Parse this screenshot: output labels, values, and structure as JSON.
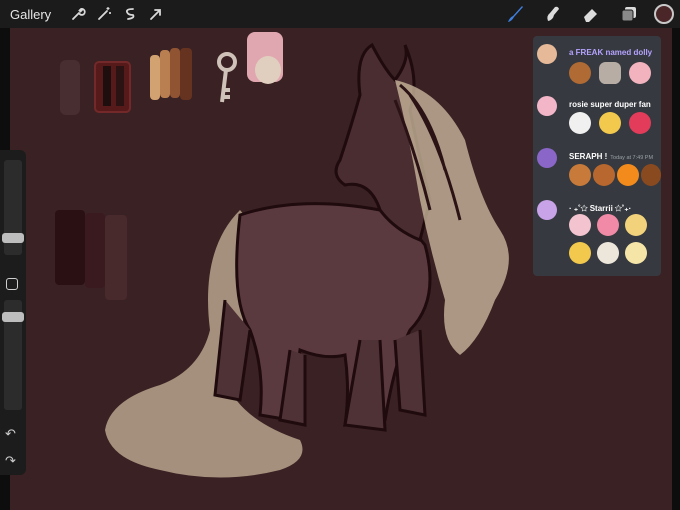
{
  "app": {
    "gallery_label": "Gallery"
  },
  "toolbar_left": [
    {
      "name": "actions-wrench-icon"
    },
    {
      "name": "adjustments-wand-icon"
    },
    {
      "name": "selection-s-icon"
    },
    {
      "name": "transform-arrow-icon"
    }
  ],
  "toolbar_right": [
    {
      "name": "brush-icon"
    },
    {
      "name": "smudge-icon"
    },
    {
      "name": "eraser-icon"
    },
    {
      "name": "layers-icon"
    }
  ],
  "current_color": "#4a2629",
  "sidebar": {
    "undo_glyph": "↶",
    "redo_glyph": "↷"
  },
  "discord": {
    "messages": [
      {
        "user": "a FREAK named dolly",
        "timestamp": "",
        "name_color": "#b5a3ff",
        "avatar_color": "#e6b999",
        "emoji": [
          "cookie",
          "key",
          "pink-seashell"
        ]
      },
      {
        "user": "rosie super duper fan",
        "timestamp": "",
        "name_color": "#ffffff",
        "avatar_color": "#f3b6c8",
        "emoji": [
          "sheep",
          "sparkles",
          "heart"
        ]
      },
      {
        "user": "SERAPH !",
        "timestamp": "Today at 7:49 PM",
        "name_color": "#ffffff",
        "avatar_color": "#8a66c8",
        "emoji": [
          "leaf",
          "leaf",
          "fire",
          "pie"
        ]
      },
      {
        "user": "· ₊˚✩ Starrii ✩˚₊·",
        "timestamp": "",
        "name_color": "#ffffff",
        "avatar_color": "#c9a3e8",
        "emoji": [
          "sweets",
          "cupcake",
          "rainbow-cloud",
          "sparkles",
          "candle",
          "flower"
        ]
      }
    ]
  }
}
